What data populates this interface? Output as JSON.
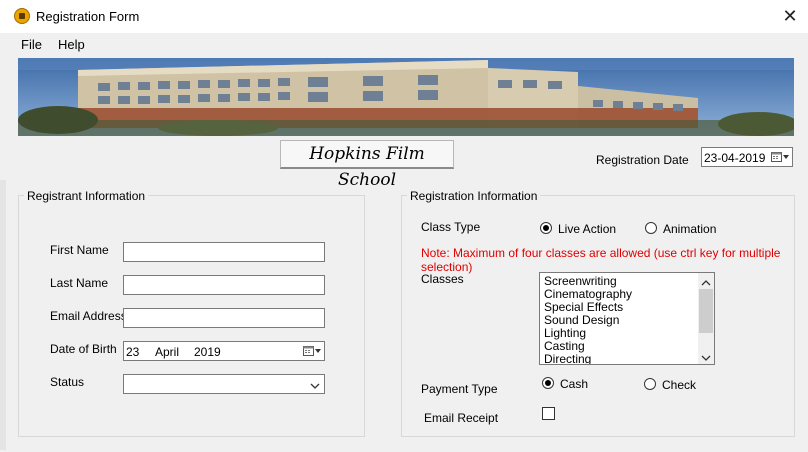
{
  "window": {
    "title": "Registration Form"
  },
  "menu": {
    "file": "File",
    "help": "Help"
  },
  "header": {
    "school_name": "Hopkins Film School",
    "registration_date_label": "Registration Date",
    "registration_date_value": "23-04-2019"
  },
  "registrant": {
    "group_title": "Registrant Information",
    "first_name_label": "First Name",
    "last_name_label": "Last Name",
    "email_label": "Email Address",
    "dob_label": "Date of Birth",
    "dob_day": "23",
    "dob_month": "April",
    "dob_year": "2019",
    "status_label": "Status",
    "first_name_value": "",
    "last_name_value": "",
    "email_value": "",
    "status_value": ""
  },
  "registration": {
    "group_title": "Registration Information",
    "class_type_label": "Class Type",
    "live_action_label": "Live Action",
    "animation_label": "Animation",
    "note": "Note: Maximum of four classes are allowed  (use ctrl key for multiple selection)",
    "classes_label": "Classes",
    "classes": [
      "Screenwriting",
      "Cinematography",
      "Special Effects",
      "Sound Design",
      "Lighting",
      "Casting",
      "Directing"
    ],
    "payment_type_label": "Payment Type",
    "cash_label": "Cash",
    "check_label": "Check",
    "email_receipt_label": "Email Receipt"
  },
  "colors": {
    "note_red": "#e00000",
    "window_bg": "#f0f0f0"
  }
}
